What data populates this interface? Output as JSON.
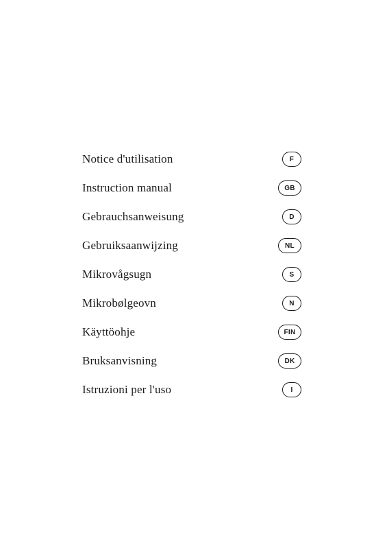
{
  "menu": {
    "items": [
      {
        "label": "Notice d'utilisation",
        "badge": "F",
        "wide": false
      },
      {
        "label": "Instruction manual",
        "badge": "GB",
        "wide": true
      },
      {
        "label": "Gebrauchsanweisung",
        "badge": "D",
        "wide": false
      },
      {
        "label": "Gebruiksaanwijzing",
        "badge": "NL",
        "wide": true
      },
      {
        "label": "Mikrovågsugn",
        "badge": "S",
        "wide": false
      },
      {
        "label": "Mikrobølgeovn",
        "badge": "N",
        "wide": false
      },
      {
        "label": "Käyttöohje",
        "badge": "FIN",
        "wide": true
      },
      {
        "label": "Bruksanvisning",
        "badge": "DK",
        "wide": true
      },
      {
        "label": "Istruzioni per l'uso",
        "badge": "I",
        "wide": false
      }
    ]
  }
}
